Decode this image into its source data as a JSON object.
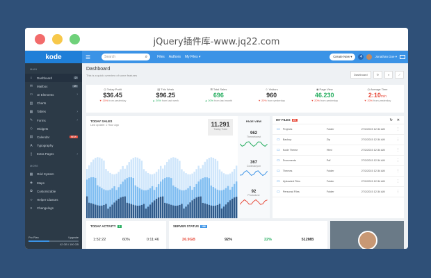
{
  "browser": {
    "title": "jQuery插件库-www.jq22.com"
  },
  "topbar": {
    "logo": "kode",
    "search_placeholder": "Search",
    "nav": [
      "Files",
      "Authors",
      "My Files ▾"
    ],
    "create_label": "Create New ▾",
    "notifications": "4",
    "user_name": "Jonathan Doe ▾"
  },
  "sidebar": {
    "main_heading": "MAIN",
    "items": [
      {
        "label": "Dashboard",
        "icon": "home-icon",
        "badge": "2"
      },
      {
        "label": "Mailbox",
        "icon": "mail-icon",
        "badge": "19"
      },
      {
        "label": "UI Elements",
        "icon": "laptop-icon",
        "chevron": true
      },
      {
        "label": "Charts",
        "icon": "bar-chart-icon"
      },
      {
        "label": "Tables",
        "icon": "table-icon",
        "chevron": true
      },
      {
        "label": "Forms",
        "icon": "pencil-icon",
        "chevron": true
      },
      {
        "label": "Widgets",
        "icon": "diamond-icon"
      },
      {
        "label": "Calendar",
        "icon": "calendar-icon",
        "badge": "NEW"
      },
      {
        "label": "Typography",
        "icon": "font-icon"
      },
      {
        "label": "Extra Pages",
        "icon": "file-icon",
        "chevron": true
      }
    ],
    "more_heading": "MORE",
    "more_items": [
      {
        "label": "Grid System",
        "icon": "grid-icon"
      },
      {
        "label": "Maps",
        "icon": "map-icon"
      },
      {
        "label": "Customizable",
        "icon": "paint-icon"
      },
      {
        "label": "Helper Classes",
        "icon": "code-icon"
      },
      {
        "label": "Changelogs",
        "icon": "list-icon"
      }
    ],
    "plan": {
      "label": "Pro Plan",
      "action": "Upgrade",
      "usage": "42 GB / 100 GB",
      "fill": 0.42
    }
  },
  "page": {
    "title": "Dashboard",
    "subtitle": "This is a quick overview of some features",
    "btn_dashboard": "Dashboard"
  },
  "stats": [
    {
      "label": "Today Profit",
      "icon": "clock-icon",
      "value": "$36.45",
      "delta": "▼ 20%",
      "delta_dir": "down",
      "note": "from yesterday"
    },
    {
      "label": "This Week",
      "icon": "calendar-icon",
      "value": "$96.25",
      "delta": "▲ 20%",
      "delta_dir": "up",
      "note": "from last week"
    },
    {
      "label": "Total Sales",
      "icon": "cart-icon",
      "value": "696",
      "value_color": "#27ae60",
      "delta": "▲ 20%",
      "delta_dir": "up",
      "note": "from last month"
    },
    {
      "label": "Visitors",
      "icon": "users-icon",
      "value": "960",
      "delta": "▼ 20%",
      "delta_dir": "down",
      "note": "from yesterday"
    },
    {
      "label": "Page View",
      "icon": "eye-icon",
      "value": "46.230",
      "value_color": "#27ae60",
      "delta": "▼ 20%",
      "delta_dir": "down",
      "note": "from yesterday"
    },
    {
      "label": "Average Time",
      "icon": "clock-icon",
      "value": "2:10",
      "value_unit": "min",
      "value_color": "#e74c3c",
      "delta": "▼ 20%",
      "delta_dir": "down",
      "note": "from yesterday"
    }
  ],
  "sales": {
    "title": "TODAY SALES",
    "updated": "Last update: 1 Hour Ago",
    "total_value": "11.291",
    "total_label": "Today Total",
    "page_view_title": "PAGE VIEW",
    "page_views": [
      {
        "value": "962",
        "label": "Themeforest",
        "color": "#27ae60"
      },
      {
        "value": "367",
        "label": "Codecanyon",
        "color": "#3b93e6"
      },
      {
        "value": "92",
        "label": "Photodune",
        "color": "#e74c3c"
      }
    ]
  },
  "files": {
    "title": "MY FILES",
    "badge": "20",
    "rows": [
      {
        "name": "Projects",
        "type": "Folder",
        "date": "27/2/2015 12:34 AM"
      },
      {
        "name": "Backup",
        "type": "Zip",
        "date": "27/2/2015 12:34 AM"
      },
      {
        "name": "Kode Theme",
        "type": "Html",
        "date": "27/2/2015 12:34 AM"
      },
      {
        "name": "Documents",
        "type": "Pdf",
        "date": "27/2/2015 12:34 AM"
      },
      {
        "name": "Themes",
        "type": "Folder",
        "date": "27/2/2015 12:34 AM"
      },
      {
        "name": "Uploaded Files",
        "type": "Folder",
        "date": "27/2/2015 12:34 AM"
      },
      {
        "name": "Personal Files",
        "type": "Folder",
        "date": "27/2/2015 12:34 AM"
      }
    ]
  },
  "activity": {
    "title": "TODAY ACTIVITY",
    "badge": "9",
    "values": [
      "1:52:22",
      "60%",
      "0:11:46"
    ]
  },
  "server": {
    "title": "SERVER STATUS",
    "badge": "186",
    "values": [
      "26.9GB",
      "92%",
      "22%",
      "512MB"
    ],
    "colors": [
      "#e74c3c",
      "#333333",
      "#27ae60",
      "#333333"
    ]
  }
}
